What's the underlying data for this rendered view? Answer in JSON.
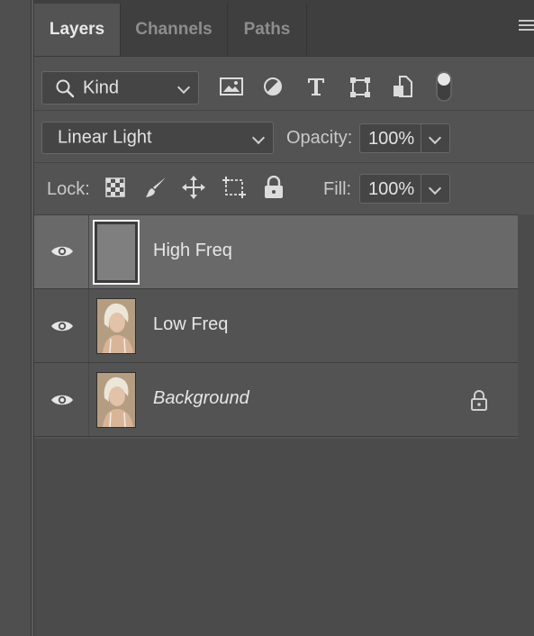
{
  "tabs": [
    {
      "label": "Layers",
      "active": true
    },
    {
      "label": "Channels",
      "active": false
    },
    {
      "label": "Paths",
      "active": false
    }
  ],
  "filter": {
    "kind_label": "Kind",
    "icons": [
      "search-icon",
      "image-filter-icon",
      "adjustment-filter-icon",
      "type-filter-icon",
      "shape-filter-icon",
      "smart-object-filter-icon",
      "filter-toggle-icon"
    ]
  },
  "blend": {
    "mode": "Linear Light",
    "opacity_label": "Opacity:",
    "opacity_value": "100%"
  },
  "lock": {
    "label": "Lock:",
    "icons": [
      "lock-transparent-pixels-icon",
      "lock-image-pixels-icon",
      "lock-position-icon",
      "lock-artboard-icon",
      "lock-all-icon"
    ],
    "fill_label": "Fill:",
    "fill_value": "100%"
  },
  "layers": [
    {
      "name": "High Freq",
      "selected": true,
      "visible": true,
      "thumbnail": "gray-fill"
    },
    {
      "name": "Low Freq",
      "selected": false,
      "visible": true,
      "thumbnail": "portrait-photo"
    },
    {
      "name": "Background",
      "selected": false,
      "visible": true,
      "thumbnail": "portrait-photo",
      "locked": true
    }
  ],
  "colors": {
    "panel_bg": "#535353",
    "tabbar_bg": "#3f3f3f",
    "selected_layer_bg": "#696969"
  }
}
